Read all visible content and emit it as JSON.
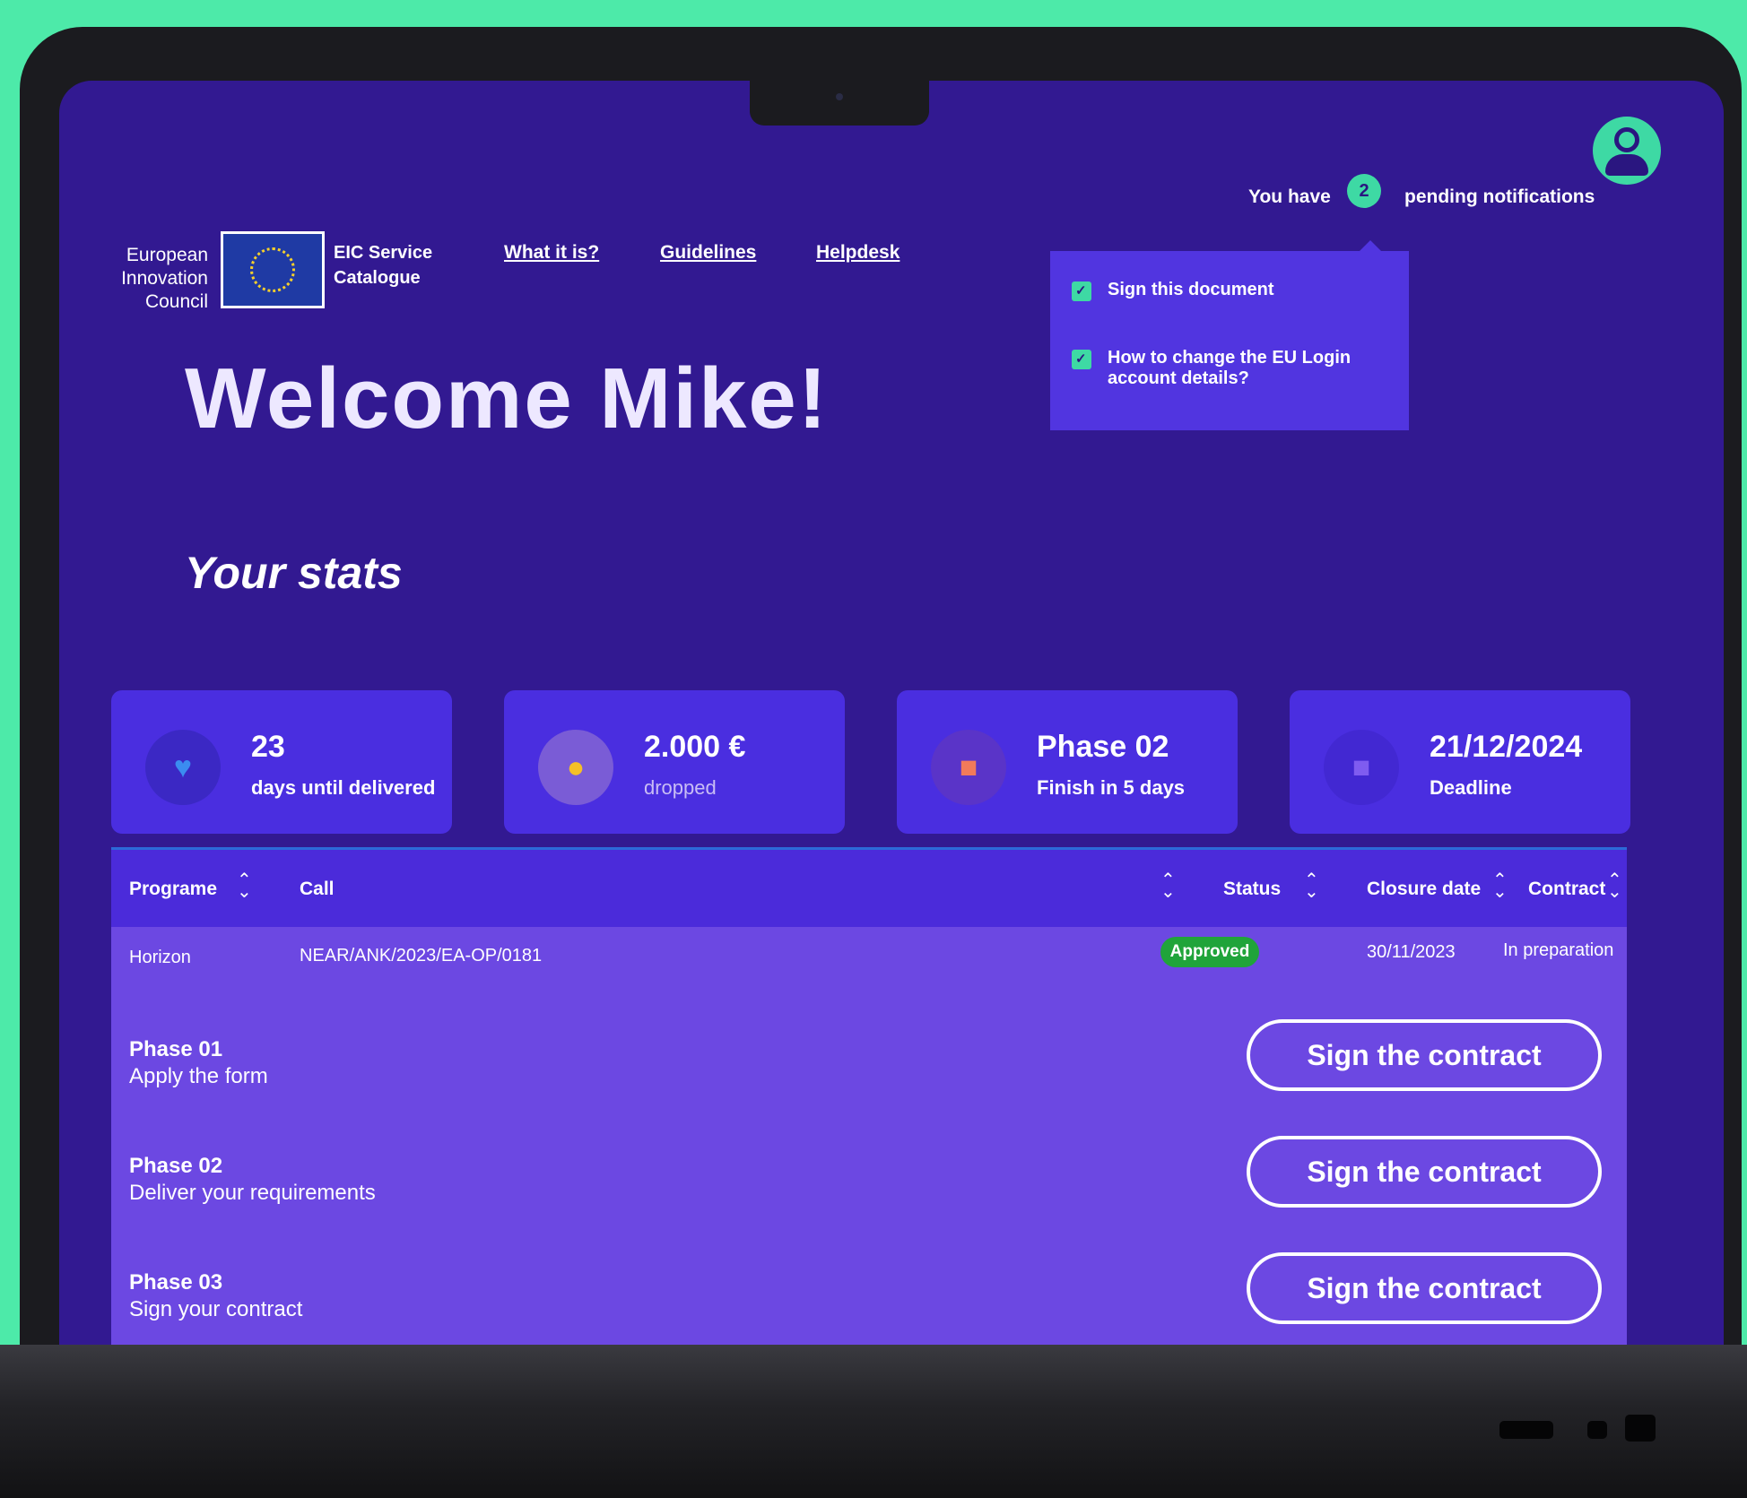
{
  "header": {
    "logo_lines": [
      "European",
      "Innovation",
      "Council"
    ],
    "service_name": "EIC Service Catalogue",
    "nav": [
      "What it is?",
      "Guidelines",
      "Helpdesk"
    ]
  },
  "notifications": {
    "prefix": "You have",
    "count": "2",
    "suffix": "pending notifications",
    "items": [
      "Sign this document",
      "How to change the EU Login account details?"
    ]
  },
  "welcome": "Welcome Mike!",
  "stats_title": "Your stats",
  "stats": [
    {
      "value": "23",
      "label": "days until delivered",
      "icon": "heart-icon",
      "icon_color": "#3b8cf0"
    },
    {
      "value": "2.000 €",
      "label": "dropped",
      "icon": "piggy-bank-icon",
      "icon_color": "#f5c026"
    },
    {
      "value": "Phase 02",
      "label": "Finish in 5 days",
      "icon": "bag-icon",
      "icon_color": "#f27a5a"
    },
    {
      "value": "21/12/2024",
      "label": "Deadline",
      "icon": "briefcase-icon",
      "icon_color": "#7f5cf0"
    }
  ],
  "table": {
    "columns": [
      "Programe",
      "Call",
      "Status",
      "Closure date",
      "Contract"
    ],
    "row": {
      "programe": "Horizon",
      "call": "NEAR/ANK/2023/EA-OP/0181",
      "status": "Approved",
      "closure_date": "30/11/2023",
      "contract": "In preparation"
    },
    "phases": [
      {
        "title": "Phase 01",
        "subtitle": "Apply the form",
        "button": "Sign the contract"
      },
      {
        "title": "Phase 02",
        "subtitle": "Deliver your requirements",
        "button": "Sign the contract"
      },
      {
        "title": "Phase 03",
        "subtitle": "Sign your contract",
        "button": "Sign the contract"
      }
    ]
  },
  "colors": {
    "background": "#4deaa9",
    "screen": "#321991",
    "card": "#4a2ee0",
    "accent": "#3ed9a4",
    "approved": "#20a43a"
  }
}
